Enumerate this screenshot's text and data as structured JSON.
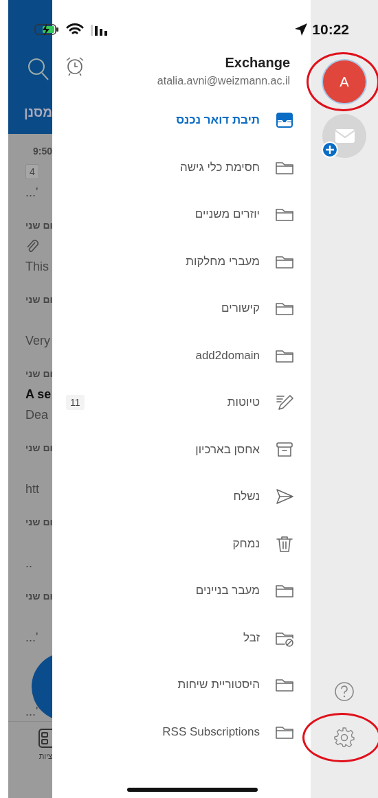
{
  "status_bar": {
    "time": "10:22"
  },
  "background_app": {
    "filter_label": "מסנן",
    "messages": [
      {
        "date": "9:50",
        "badge": "4",
        "preview": "...'"
      },
      {
        "date": "ום שני",
        "attachment": true,
        "preview": "This"
      },
      {
        "date": "ום שני",
        "preview": "Very"
      },
      {
        "date": "ום שני",
        "subject": "A se",
        "preview": "Dea"
      },
      {
        "date": "ום שני",
        "preview": "htt"
      },
      {
        "date": "ום שני",
        "preview": ".."
      },
      {
        "date": "ום שני",
        "preview": "...'"
      },
      {
        "preview": "...'"
      }
    ],
    "tab_label": "ציות"
  },
  "account": {
    "name": "Exchange",
    "email": "atalia.avni@weizmann.ac.il"
  },
  "folders": [
    {
      "kind": "inbox",
      "label": "תיבת דואר נכנס",
      "selected": true
    },
    {
      "kind": "folder",
      "label": "חסימת כלי גישה",
      "selected": false
    },
    {
      "kind": "folder",
      "label": "יוזרים משניים",
      "selected": false
    },
    {
      "kind": "folder",
      "label": "מעברי מחלקות",
      "selected": false
    },
    {
      "kind": "folder",
      "label": "קישורים",
      "selected": false
    },
    {
      "kind": "folder",
      "label": "add2domain",
      "selected": false
    },
    {
      "kind": "drafts",
      "label": "טיוטות",
      "count": "11",
      "selected": false
    },
    {
      "kind": "archive",
      "label": "אחסן בארכיון",
      "selected": false
    },
    {
      "kind": "sent",
      "label": "נשלח",
      "selected": false
    },
    {
      "kind": "trash",
      "label": "נמחק",
      "selected": false
    },
    {
      "kind": "folder",
      "label": "מעבר בניינים",
      "selected": false
    },
    {
      "kind": "junk",
      "label": "זבל",
      "selected": false
    },
    {
      "kind": "folder",
      "label": "היסטוריית שיחות",
      "selected": false
    },
    {
      "kind": "folder",
      "label": "RSS Subscriptions",
      "selected": false
    }
  ],
  "accounts_rail": [
    {
      "initial": "A",
      "color": "#e0463c",
      "selected": true
    }
  ]
}
